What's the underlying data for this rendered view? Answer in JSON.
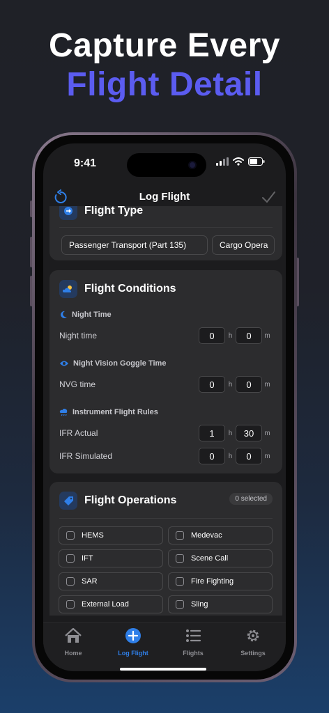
{
  "headline": {
    "line1": "Capture Every",
    "line2": "Flight Detail"
  },
  "status": {
    "time": "9:41"
  },
  "nav": {
    "title": "Log Flight"
  },
  "flight_type": {
    "title": "Flight Type",
    "chips": [
      "Passenger Transport (Part 135)",
      "Cargo Opera"
    ]
  },
  "conditions": {
    "title": "Flight Conditions",
    "night": {
      "heading": "Night Time",
      "label": "Night time",
      "h": "0",
      "m": "0"
    },
    "nvg": {
      "heading": "Night Vision Goggle Time",
      "label": "NVG time",
      "h": "0",
      "m": "0"
    },
    "ifr": {
      "heading": "Instrument Flight Rules",
      "actual": {
        "label": "IFR Actual",
        "h": "1",
        "m": "30"
      },
      "simulated": {
        "label": "IFR Simulated",
        "h": "0",
        "m": "0"
      }
    },
    "unit_h": "h",
    "unit_m": "m"
  },
  "operations": {
    "title": "Flight Operations",
    "badge": "0 selected",
    "items": [
      "HEMS",
      "Medevac",
      "IFT",
      "Scene Call",
      "SAR",
      "Fire Fighting",
      "External Load",
      "Sling"
    ]
  },
  "tabs": [
    {
      "label": "Home",
      "icon": "house-icon"
    },
    {
      "label": "Log Flight",
      "icon": "plus-circle-icon"
    },
    {
      "label": "Flights",
      "icon": "list-icon"
    },
    {
      "label": "Settings",
      "icon": "gear-icon"
    }
  ],
  "colors": {
    "accent": "#2f7fe8",
    "headline_accent": "#5b5cf0",
    "card": "#2c2c2e",
    "screen": "#1c1c1e"
  }
}
